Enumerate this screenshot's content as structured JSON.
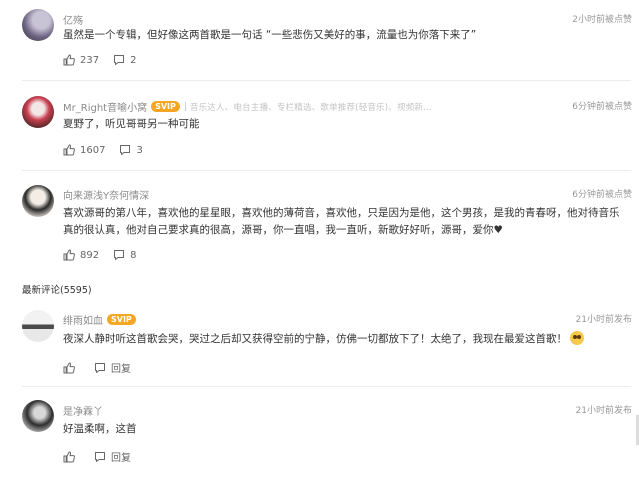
{
  "hot_comments": [
    {
      "user": "亿殇",
      "time": "2小时前被点赞",
      "text": "虽然是一个专辑，但好像这两首歌是一句话 “一些悲伤又美好的事，流量也为你落下来了”",
      "likes": "237",
      "replies": "2"
    },
    {
      "user": "Mr_Right音喻小窝",
      "badge": "SVIP",
      "tags": "音乐达人、电台主播、专栏精选、歌单推荐(轻音乐)、视频新...",
      "time": "6分钟前被点赞",
      "text": "夏野了，听见哥哥另一种可能",
      "likes": "1607",
      "replies": "3"
    },
    {
      "user": "向来源浅Y奈何情深",
      "time": "6分钟前被点赞",
      "text": "喜欢源哥的第八年，喜欢他的星星眼，喜欢他的薄荷音，喜欢他，只是因为是他，这个男孩，是我的青春呀，他对待音乐真的很认真，他对自己要求真的很高，源哥，你一直唱，我一直听，新歌好好听，源哥，爱你♥",
      "likes": "892",
      "replies": "8"
    }
  ],
  "latest_section": {
    "title": "最新评论(5595)"
  },
  "latest_comments": [
    {
      "user": "绯雨如血",
      "badge": "SVIP",
      "time": "21小时前发布",
      "text": "夜深人静时听这首歌会哭，哭过之后却又获得空前的宁静，仿佛一切都放下了！太绝了，我现在最爱这首歌！",
      "reply_label": "回复"
    },
    {
      "user": "是净霖丫",
      "time": "21小时前发布",
      "text": "好温柔啊，这首",
      "reply_label": "回复"
    }
  ],
  "icons": [
    "like-icon",
    "reply-icon",
    "emoji-icon"
  ],
  "colors": {
    "svip_badge": "#f5a623",
    "svip_badge_alt": "#e8728f",
    "divider": "#ececec"
  }
}
